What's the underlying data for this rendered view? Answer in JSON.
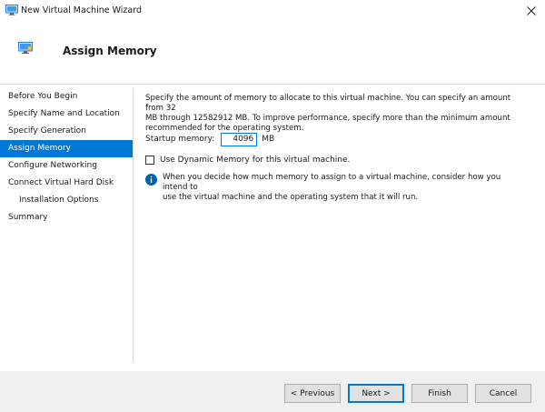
{
  "window": {
    "title": "New Virtual Machine Wizard",
    "icon": "virtual-machine-icon",
    "close_icon": "close-icon"
  },
  "header": {
    "title": "Assign Memory",
    "icon": "memory-icon"
  },
  "nav": {
    "items": [
      {
        "label": "Before You Begin",
        "active": false
      },
      {
        "label": "Specify Name and Location",
        "active": false
      },
      {
        "label": "Specify Generation",
        "active": false
      },
      {
        "label": "Assign Memory",
        "active": true
      },
      {
        "label": "Configure Networking",
        "active": false
      },
      {
        "label": "Connect Virtual Hard Disk",
        "active": false
      },
      {
        "label": "Installation Options",
        "active": false,
        "sub": true
      },
      {
        "label": "Summary",
        "active": false
      }
    ]
  },
  "main": {
    "description_line1": "Specify the amount of memory to allocate to this virtual machine. You can specify an amount from 32",
    "description_line2": "MB through 12582912 MB. To improve performance, specify more than the minimum amount",
    "description_line3": "recommended for the operating system.",
    "startup_memory_label": "Startup memory:",
    "startup_memory_value": "4096",
    "startup_memory_unit": "MB",
    "dynamic_memory_label": "Use Dynamic Memory for this virtual machine.",
    "dynamic_memory_checked": false,
    "info_line1": "When you decide how much memory to assign to a virtual machine, consider how you intend to",
    "info_line2": "use the virtual machine and the operating system that it will run.",
    "info_icon": "info-icon"
  },
  "footer": {
    "previous_label": "< Previous",
    "next_label": "Next >",
    "finish_label": "Finish",
    "cancel_label": "Cancel"
  },
  "colors": {
    "accent": "#0078d7",
    "footer_bg": "#f0f0f0",
    "button_bg": "#e1e1e1"
  }
}
